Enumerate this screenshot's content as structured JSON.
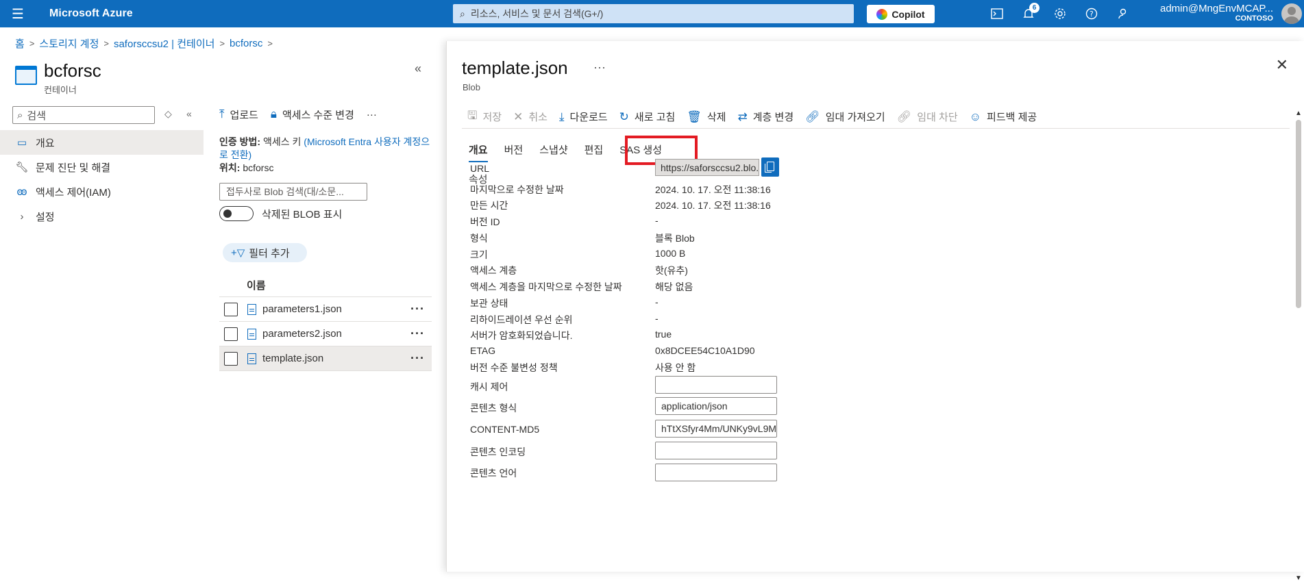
{
  "topbar": {
    "brand": "Microsoft Azure",
    "search_placeholder": "리소스, 서비스 및 문서 검색(G+/)",
    "copilot": "Copilot",
    "notifications_count": "6",
    "account_user": "admin@MngEnvMCAP...",
    "account_tenant": "CONTOSO"
  },
  "breadcrumb": [
    "홈",
    "스토리지 계정",
    "saforsccsu2 | 컨테이너",
    "bcforsc"
  ],
  "left": {
    "title": "bcforsc",
    "subtitle": "컨테이너",
    "search_placeholder": "검색",
    "nav": [
      {
        "label": "개요",
        "icon": "overview-icon"
      },
      {
        "label": "문제 진단 및 해결",
        "icon": "wrench-icon"
      },
      {
        "label": "액세스 제어(IAM)",
        "icon": "people-icon"
      },
      {
        "label": "설정",
        "icon": "chevron-right-icon"
      }
    ]
  },
  "middle": {
    "toolbar": {
      "upload": "업로드",
      "access_level": "액세스 수준 변경",
      "more": "···"
    },
    "auth_label": "인증 방법:",
    "auth_value": "액세스 키",
    "auth_link": "(Microsoft Entra 사용자 계정으로 전환)",
    "location_label": "위치:",
    "location_value": "bcforsc",
    "blob_search_placeholder": "접두사로 Blob 검색(대/소문...",
    "show_deleted": "삭제된 BLOB 표시",
    "add_filter": "필터 추가",
    "column_name": "이름",
    "files": [
      "parameters1.json",
      "parameters2.json",
      "template.json"
    ]
  },
  "panel": {
    "title": "template.json",
    "subtitle": "Blob",
    "toolbar": {
      "save": "저장",
      "discard": "취소",
      "download": "다운로드",
      "refresh": "새로 고침",
      "delete": "삭제",
      "change_tier": "계층 변경",
      "acquire_lease": "임대 가져오기",
      "break_lease": "임대 차단",
      "feedback": "피드백 제공"
    },
    "tabs": [
      "개요",
      "버전",
      "스냅샷",
      "편집",
      "SAS 생성"
    ],
    "props_heading": "속성",
    "url_label": "URL",
    "url_value": "https://saforsccsu2.blo...",
    "properties": [
      {
        "label": "마지막으로 수정한 날짜",
        "value": "2024. 10. 17. 오전 11:38:16"
      },
      {
        "label": "만든 시간",
        "value": "2024. 10. 17. 오전 11:38:16"
      },
      {
        "label": "버전 ID",
        "value": "-"
      },
      {
        "label": "형식",
        "value": "블록 Blob"
      },
      {
        "label": "크기",
        "value": "1000 B"
      },
      {
        "label": "액세스 계층",
        "value": "핫(유추)"
      },
      {
        "label": "액세스 계층을 마지막으로 수정한 날짜",
        "value": "해당 없음"
      },
      {
        "label": "보관 상태",
        "value": "-"
      },
      {
        "label": "리하이드레이션 우선 순위",
        "value": "-"
      },
      {
        "label": "서버가 암호화되었습니다.",
        "value": "true"
      },
      {
        "label": "ETAG",
        "value": "0x8DCEE54C10A1D90"
      },
      {
        "label": "버전 수준 불변성 정책",
        "value": "사용 안 함"
      }
    ],
    "inputs": [
      {
        "label": "캐시 제어",
        "value": ""
      },
      {
        "label": "콘텐츠 형식",
        "value": "application/json"
      },
      {
        "label": "CONTENT-MD5",
        "value": "hTtXSfyr4Mm/UNKy9vL9Mg..."
      },
      {
        "label": "콘텐츠 인코딩",
        "value": ""
      },
      {
        "label": "콘텐츠 언어",
        "value": ""
      }
    ]
  }
}
